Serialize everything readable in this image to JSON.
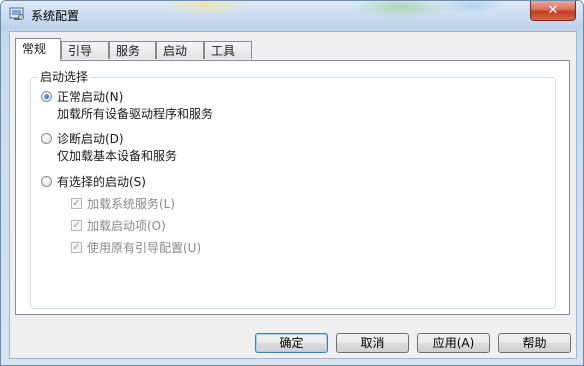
{
  "window": {
    "title": "系统配置",
    "close_label": "✕"
  },
  "tabs": [
    {
      "label": "常规",
      "active": true
    },
    {
      "label": "引导",
      "active": false
    },
    {
      "label": "服务",
      "active": false
    },
    {
      "label": "启动",
      "active": false
    },
    {
      "label": "工具",
      "active": false
    }
  ],
  "startup_selection": {
    "group_label": "启动选择",
    "options": [
      {
        "label": "正常启动(N)",
        "description": "加载所有设备驱动程序和服务",
        "checked": true
      },
      {
        "label": "诊断启动(D)",
        "description": "仅加载基本设备和服务",
        "checked": false
      },
      {
        "label": "有选择的启动(S)",
        "checked": false
      }
    ],
    "selective_items": [
      {
        "label": "加载系统服务(L)",
        "checked": true,
        "enabled": false
      },
      {
        "label": "加载启动项(O)",
        "checked": true,
        "enabled": false
      },
      {
        "label": "使用原有引导配置(U)",
        "checked": true,
        "enabled": false
      }
    ]
  },
  "buttons": {
    "ok": "确定",
    "cancel": "取消",
    "apply": "应用(A)",
    "help": "帮助"
  }
}
